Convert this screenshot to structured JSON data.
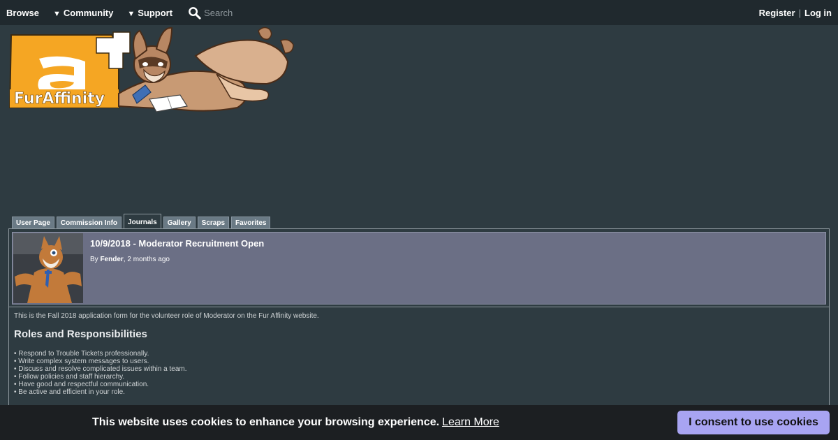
{
  "nav": {
    "browse": "Browse",
    "community": "Community",
    "support": "Support",
    "search_placeholder": "Search",
    "register": "Register",
    "separator": "|",
    "login": "Log in",
    "caret": "▼"
  },
  "logo": {
    "text": "FurAffinity"
  },
  "tabs": [
    {
      "label": "User Page"
    },
    {
      "label": "Commission Info"
    },
    {
      "label": "Journals"
    },
    {
      "label": "Gallery"
    },
    {
      "label": "Scraps"
    },
    {
      "label": "Favorites"
    }
  ],
  "journal": {
    "title": "10/9/2018 - Moderator Recruitment Open",
    "by_label": "By",
    "author": "Fender",
    "time": ", 2 months ago",
    "intro": "This is the Fall 2018 application form for the volunteer role of Moderator on the Fur Affinity website.",
    "heading": "Roles and Responsibilities",
    "bullets": [
      "• Respond to Trouble Tickets professionally.",
      "• Write complex system messages to users.",
      "• Discuss and resolve complicated issues within a team.",
      "• Follow policies and staff hierarchy.",
      "• Have good and respectful communication.",
      "• Be active and efficient in your role."
    ]
  },
  "cookie": {
    "message": "This website uses cookies to enhance your browsing experience.",
    "link": "Learn More",
    "button": "I consent to use cookies"
  },
  "colors": {
    "background": "#2e3b41",
    "nav_bar": "#20292e",
    "header_panel": "#6b6f85",
    "tab": "#6a7a85",
    "cookie_button": "#a8a4f2",
    "logo_orange": "#f5a623"
  }
}
